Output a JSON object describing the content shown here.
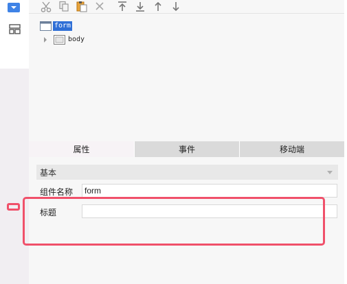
{
  "rail": {
    "items": [
      {
        "icon": "dropdown-icon"
      },
      {
        "icon": "layout-icon"
      }
    ]
  },
  "toolbar": {
    "buttons": [
      {
        "icon": "cut-icon"
      },
      {
        "icon": "copy-icon"
      },
      {
        "icon": "paste-icon"
      },
      {
        "icon": "delete-icon"
      },
      {
        "icon": "move-top-icon"
      },
      {
        "icon": "move-bottom-icon"
      },
      {
        "icon": "move-up-icon"
      },
      {
        "icon": "move-down-icon"
      }
    ]
  },
  "tree": {
    "nodes": [
      {
        "label": "form",
        "selected": true
      },
      {
        "label": "body",
        "selected": false
      }
    ]
  },
  "tabs": [
    {
      "label": "属性",
      "active": true
    },
    {
      "label": "事件",
      "active": false
    },
    {
      "label": "移动端",
      "active": false
    }
  ],
  "properties": {
    "section_title": "基本",
    "fields": [
      {
        "label": "组件名称",
        "value": "form"
      },
      {
        "label": "标题",
        "value": ""
      }
    ]
  },
  "colors": {
    "selection": "#2f6fd6",
    "accent": "#3f83e6",
    "highlight": "#f0506a"
  }
}
